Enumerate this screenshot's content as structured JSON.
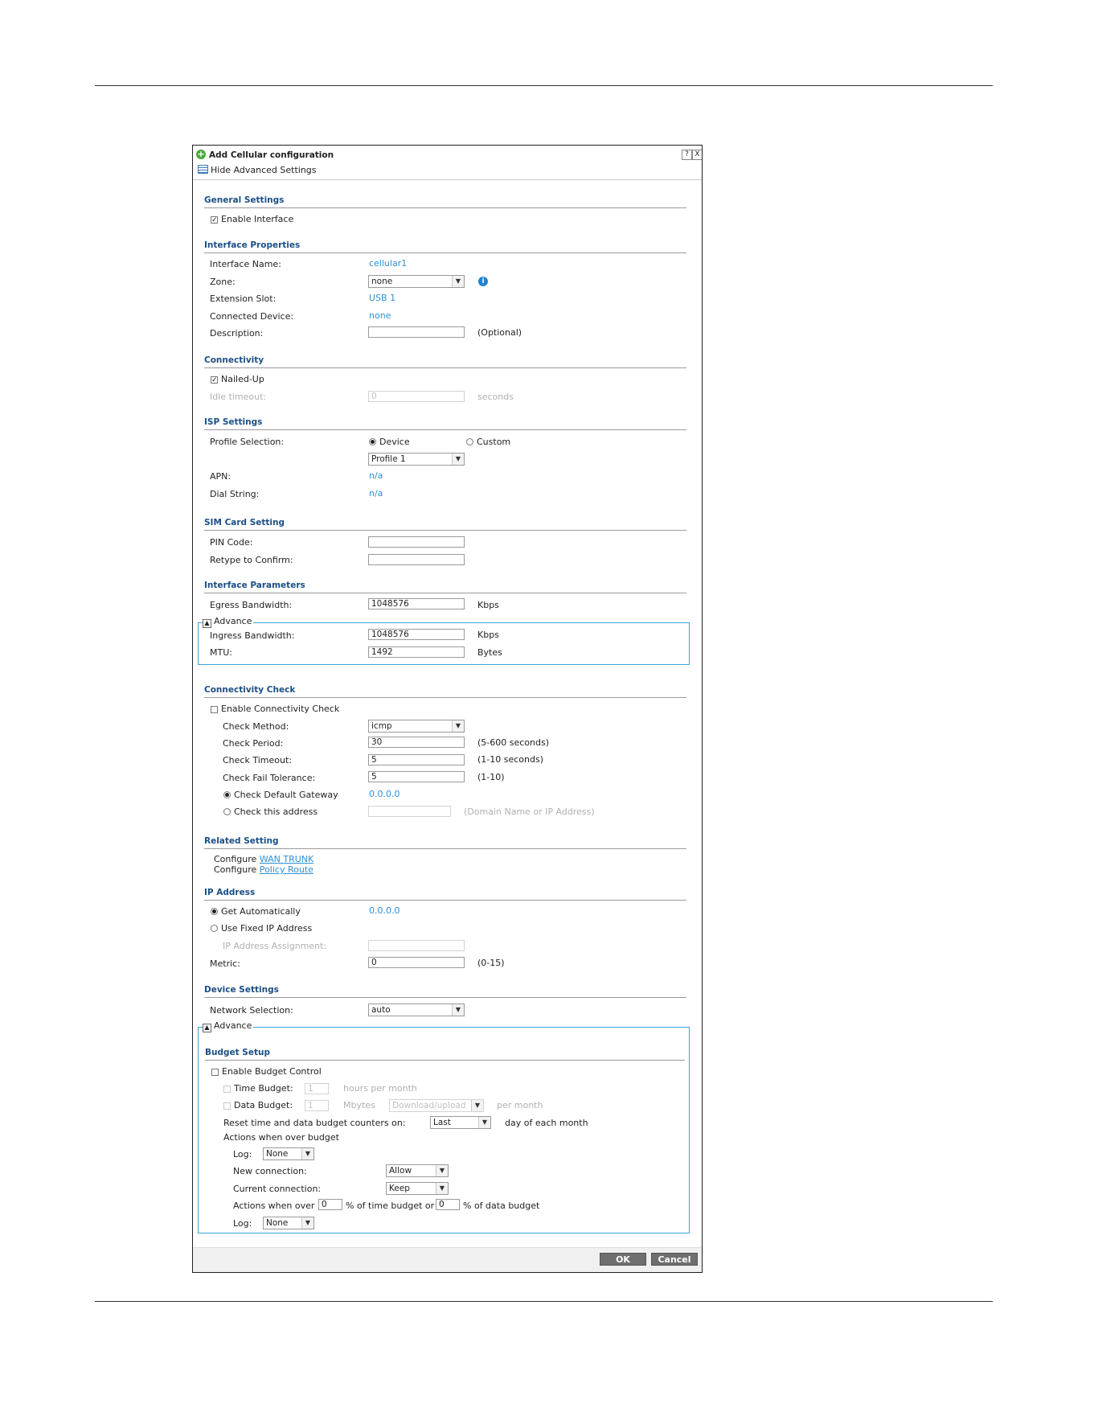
{
  "dialog": {
    "title": "Add Cellular configuration",
    "help_label": "?",
    "close_label": "X",
    "advanced_toggle": "Hide Advanced Settings"
  },
  "general": {
    "title": "General Settings",
    "enable_interface": {
      "label": "Enable Interface",
      "checked": true
    }
  },
  "iface_props": {
    "title": "Interface Properties",
    "name_label": "Interface Name:",
    "name_value": "cellular1",
    "zone_label": "Zone:",
    "zone_value": "none",
    "slot_label": "Extension Slot:",
    "slot_value": "USB 1",
    "device_label": "Connected Device:",
    "device_value": "none",
    "desc_label": "Description:",
    "desc_value": "",
    "desc_hint": "(Optional)"
  },
  "connectivity": {
    "title": "Connectivity",
    "nailed_up": {
      "label": "Nailed-Up",
      "checked": true
    },
    "idle_label": "Idle timeout:",
    "idle_value": "0",
    "idle_unit": "seconds"
  },
  "isp": {
    "title": "ISP Settings",
    "profile_label": "Profile Selection:",
    "opt_device": "Device",
    "opt_custom": "Custom",
    "profile_value": "Profile 1",
    "apn_label": "APN:",
    "apn_value": "n/a",
    "dial_label": "Dial String:",
    "dial_value": "n/a"
  },
  "sim": {
    "title": "SIM Card Setting",
    "pin_label": "PIN Code:",
    "pin_value": "",
    "retype_label": "Retype to Confirm:",
    "retype_value": ""
  },
  "params": {
    "title": "Interface Parameters",
    "egress_label": "Egress Bandwidth:",
    "egress_value": "1048576",
    "egress_unit": "Kbps",
    "advance_label": "Advance",
    "ingress_label": "Ingress Bandwidth:",
    "ingress_value": "1048576",
    "ingress_unit": "Kbps",
    "mtu_label": "MTU:",
    "mtu_value": "1492",
    "mtu_unit": "Bytes"
  },
  "check": {
    "title": "Connectivity Check",
    "enable": {
      "label": "Enable Connectivity Check",
      "checked": false
    },
    "method_label": "Check Method:",
    "method_value": "icmp",
    "period_label": "Check Period:",
    "period_value": "30",
    "period_hint": "(5-600 seconds)",
    "timeout_label": "Check Timeout:",
    "timeout_value": "5",
    "timeout_hint": "(1-10 seconds)",
    "tolerance_label": "Check Fail Tolerance:",
    "tolerance_value": "5",
    "tolerance_hint": "(1-10)",
    "gateway_label": "Check Default Gateway",
    "gateway_value": "0.0.0.0",
    "address_label": "Check this address",
    "address_value": "",
    "address_hint": "(Domain Name or IP Address)"
  },
  "related": {
    "title": "Related Setting",
    "configure1": "Configure",
    "link1": "WAN TRUNK",
    "configure2": "Configure",
    "link2": "Policy Route"
  },
  "ip": {
    "title": "IP Address",
    "auto_label": "Get Automatically",
    "auto_value": "0.0.0.0",
    "fixed_label": "Use Fixed IP Address",
    "assign_label": "IP Address Assignment:",
    "assign_value": "",
    "metric_label": "Metric:",
    "metric_value": "0",
    "metric_hint": "(0-15)"
  },
  "device": {
    "title": "Device Settings",
    "network_label": "Network Selection:",
    "network_value": "auto",
    "advance_label": "Advance"
  },
  "budget": {
    "title": "Budget Setup",
    "enable": {
      "label": "Enable Budget Control",
      "checked": false
    },
    "time_label": "Time Budget:",
    "time_value": "1",
    "time_unit": "hours per month",
    "data_label": "Data Budget:",
    "data_value": "1",
    "data_unit": "Mbytes",
    "data_dir": "Download/upload",
    "data_period": "per month",
    "reset_label": "Reset time and data budget counters on:",
    "reset_value": "Last",
    "reset_suffix": "day of each month",
    "actions_label": "Actions when over budget",
    "log_label": "Log:",
    "log_value": "None",
    "newconn_label": "New connection:",
    "newconn_value": "Allow",
    "curconn_label": "Current connection:",
    "curconn_value": "Keep",
    "over_prefix": "Actions when over",
    "over_time_value": "0",
    "over_mid": "% of time budget or",
    "over_data_value": "0",
    "over_suffix": "% of data budget",
    "log2_label": "Log:",
    "log2_value": "None"
  },
  "buttons": {
    "ok": "OK",
    "cancel": "Cancel"
  }
}
